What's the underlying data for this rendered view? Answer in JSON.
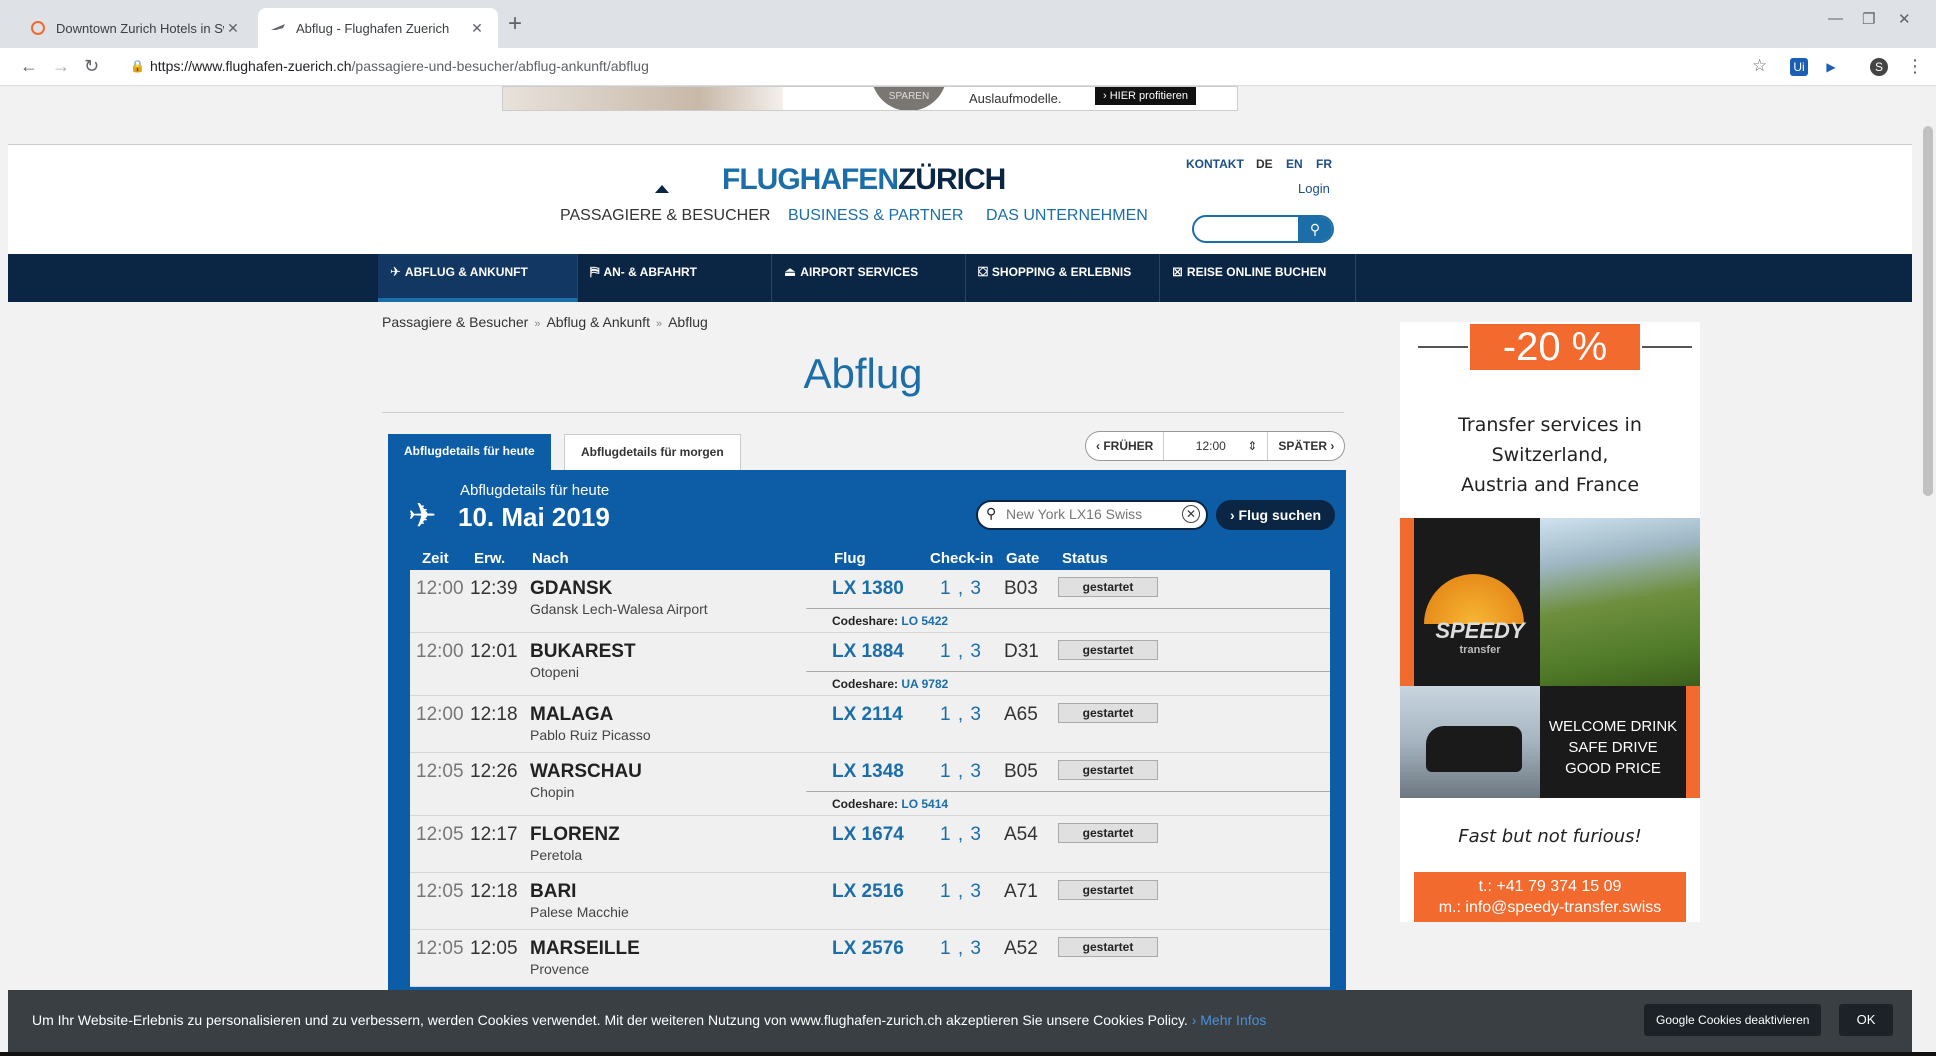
{
  "browser": {
    "tabs": [
      {
        "title": "Downtown Zurich Hotels in Switz"
      },
      {
        "title": "Abflug - Flughafen Zuerich"
      }
    ],
    "url_host": "https://www.flughafen-zuerich.ch",
    "url_path": "/passagiere-und-besucher/abflug-ankunft/abflug",
    "profile_initial": "S"
  },
  "top_ad": {
    "circle_text": "SPAREN",
    "text": "Auslaufmodelle.",
    "button": "› HIER profitieren"
  },
  "header": {
    "logo_a": "FLUGHAFEN",
    "logo_b": "ZÜRICH",
    "kontakt": "KONTAKT",
    "lang_de": "DE",
    "lang_en": "EN",
    "lang_fr": "FR",
    "login": "Login",
    "nav": [
      "PASSAGIERE & BESUCHER",
      "BUSINESS & PARTNER",
      "DAS UNTERNEHMEN"
    ]
  },
  "subnav": [
    {
      "label": "ABFLUG & ANKUNFT",
      "icon": "plane-icon"
    },
    {
      "label": "AN- & ABFAHRT",
      "icon": "transport-icon"
    },
    {
      "label": "AIRPORT SERVICES",
      "icon": "bell-icon"
    },
    {
      "label": "SHOPPING & ERLEBNIS",
      "icon": "bag-icon"
    },
    {
      "label": "REISE ONLINE BUCHEN",
      "icon": "ticket-icon"
    }
  ],
  "breadcrumb": [
    "Passagiere & Besucher",
    "Abflug & Ankunft",
    "Abflug"
  ],
  "page_title": "Abflug",
  "day_tabs": {
    "today": "Abflugdetails für heute",
    "tomorrow": "Abflugdetails für morgen"
  },
  "pager": {
    "earlier": "FRÜHER",
    "time": "12:00",
    "later": "SPÄTER"
  },
  "board": {
    "subtitle": "Abflugdetails für heute",
    "date": "10. Mai 2019",
    "search_value": "New York LX16 Swiss",
    "search_button": "› Flug suchen",
    "columns": {
      "zeit": "Zeit",
      "erw": "Erw.",
      "nach": "Nach",
      "flug": "Flug",
      "checkin": "Check-in",
      "gate": "Gate",
      "status": "Status"
    },
    "codeshare_label": "Codeshare:",
    "flights": [
      {
        "zeit": "12:00",
        "erw": "12:39",
        "dest": "GDANSK",
        "airport": "Gdansk Lech-Walesa Airport",
        "flug": "LX 1380",
        "checkin": "1 , 3",
        "gate": "B03",
        "status": "gestartet",
        "codeshare": "LO 5422"
      },
      {
        "zeit": "12:00",
        "erw": "12:01",
        "dest": "BUKAREST",
        "airport": "Otopeni",
        "flug": "LX 1884",
        "checkin": "1 , 3",
        "gate": "D31",
        "status": "gestartet",
        "codeshare": "UA 9782"
      },
      {
        "zeit": "12:00",
        "erw": "12:18",
        "dest": "MALAGA",
        "airport": "Pablo Ruiz Picasso",
        "flug": "LX 2114",
        "checkin": "1 , 3",
        "gate": "A65",
        "status": "gestartet",
        "codeshare": ""
      },
      {
        "zeit": "12:05",
        "erw": "12:26",
        "dest": "WARSCHAU",
        "airport": "Chopin",
        "flug": "LX 1348",
        "checkin": "1 , 3",
        "gate": "B05",
        "status": "gestartet",
        "codeshare": "LO 5414"
      },
      {
        "zeit": "12:05",
        "erw": "12:17",
        "dest": "FLORENZ",
        "airport": "Peretola",
        "flug": "LX 1674",
        "checkin": "1 , 3",
        "gate": "A54",
        "status": "gestartet",
        "codeshare": ""
      },
      {
        "zeit": "12:05",
        "erw": "12:18",
        "dest": "BARI",
        "airport": "Palese Macchie",
        "flug": "LX 2516",
        "checkin": "1 , 3",
        "gate": "A71",
        "status": "gestartet",
        "codeshare": ""
      },
      {
        "zeit": "12:05",
        "erw": "12:05",
        "dest": "MARSEILLE",
        "airport": "Provence",
        "flug": "LX 2576",
        "checkin": "1 , 3",
        "gate": "A52",
        "status": "gestartet",
        "codeshare": ""
      }
    ]
  },
  "side_ad": {
    "discount": "-20 %",
    "copy": [
      "Transfer services in",
      "Switzerland,",
      "Austria and France"
    ],
    "brand": "SPEEDY",
    "brand_sub": "transfer",
    "taglines": [
      "WELCOME DRINK",
      "SAFE DRIVE",
      "GOOD PRICE"
    ],
    "slogan": "Fast but not furious!",
    "phone": "t.: +41 79 374 15 09",
    "email": "m.: info@speedy-transfer.swiss"
  },
  "cookie": {
    "message": "Um Ihr Website-Erlebnis zu personalisieren und zu verbessern, werden Cookies verwendet. Mit der weiteren Nutzung von www.flughafen-zurich.ch akzeptieren Sie unsere Cookies Policy.",
    "more": "› Mehr Infos",
    "disable": "Google Cookies deaktivieren",
    "ok": "OK"
  }
}
